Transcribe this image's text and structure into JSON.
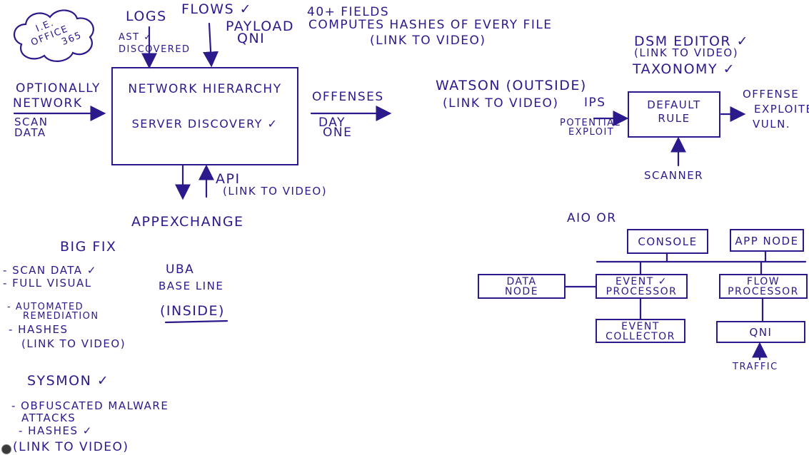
{
  "cloud_text": [
    "I.E.",
    "OFFICE",
    "365"
  ],
  "main_box": {
    "line1": "NETWORK HIERARCHY",
    "line2": "SERVER DISCOVERY ✓"
  },
  "inputs": {
    "logs": "LOGS",
    "asset_discovered": "AST ✓",
    "discovered": "DISCOVERED",
    "flows": "FLOWS ✓",
    "payload": "PAYLOAD",
    "qni": "QNI",
    "fields": "40+ FIELDS",
    "computes": "COMPUTES HASHES OF EVERY FILE",
    "link_video_top": "(LINK TO VIDEO)",
    "optionally": "OPTIONALLY",
    "network": "NETWORK",
    "scan": "SCAN",
    "data": "DATA"
  },
  "outputs": {
    "offenses": "OFFENSES",
    "day": "DAY",
    "one": "ONE",
    "api": "API",
    "api_link": "(LINK TO VIDEO)",
    "appexchange": "APPEXCHANGE"
  },
  "watson": {
    "title": "WATSON (OUTSIDE)",
    "link": "(LINK TO VIDEO)"
  },
  "dsm": {
    "editor": "DSM EDITOR ✓",
    "link": "(LINK TO VIDEO)",
    "taxonomy": "TAXONOMY ✓"
  },
  "rule": {
    "ips": "IPS",
    "potential": "POTENTIAL",
    "exploit": "EXPLOIT",
    "box_line1": "DEFAULT",
    "box_line2": "RULE",
    "scanner": "SCANNER",
    "offense": "OFFENSE",
    "exploited": "EXPLOITED",
    "vuln": "VULN."
  },
  "bigfix": {
    "title": "BIG FIX",
    "items": [
      "- SCAN DATA ✓",
      "- FULL VISUAL",
      "- AUTOMATED",
      "REMEDIATION",
      "- HASHES",
      "(LINK TO VIDEO)"
    ]
  },
  "uba": {
    "title": "UBA",
    "subtitle": "BASE LINE",
    "inside": "(INSIDE)"
  },
  "sysmon": {
    "title": "SYSMON ✓",
    "items": [
      "- OBFUSCATED MALWARE",
      "ATTACKS",
      "- HASHES ✓",
      "(LINK TO VIDEO)"
    ]
  },
  "architecture": {
    "aio": "AIO OR",
    "console": "CONSOLE",
    "app_node": "APP NODE",
    "data_node_1": "DATA",
    "data_node_2": "NODE",
    "event_processor_1": "EVENT ✓",
    "event_processor_2": "PROCESSOR",
    "flow_processor_1": "FLOW",
    "flow_processor_2": "PROCESSOR",
    "event_collector_1": "EVENT",
    "event_collector_2": "COLLECTOR",
    "qni": "QNI",
    "traffic": "TRAFFIC"
  },
  "colors": {
    "ink": "#2b1a8c",
    "background": "#ffffff"
  }
}
